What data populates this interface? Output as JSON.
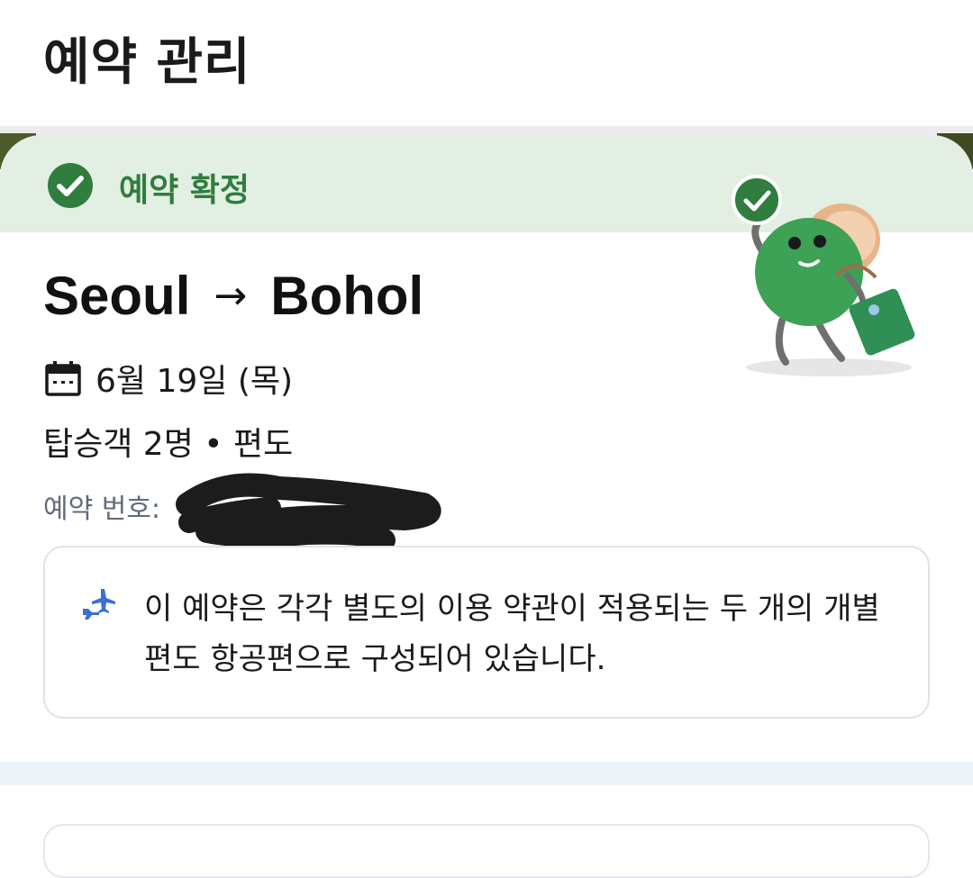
{
  "header": {
    "title": "예약 관리"
  },
  "status": {
    "label": "예약 확정",
    "color": "#2f7d3f"
  },
  "trip": {
    "origin": "Seoul",
    "arrow": "→",
    "destination": "Bohol",
    "date": "6월 19일 (목)",
    "passengers": "탑승객 2명 • 편도",
    "booking_label": "예약 번호:",
    "booking_value": ""
  },
  "notice": {
    "text": "이 예약은 각각 별도의 이용 약관이 적용되는 두 개의 개별 편도 항공편으로 구성되어 있습니다."
  },
  "icons": [
    "check-circle-icon",
    "calendar-icon",
    "planes-icon",
    "mascot-illustration"
  ],
  "colors": {
    "accent_green": "#2f7d3f",
    "banner_bg": "#e3efe2",
    "icon_blue": "#3b6fd4"
  }
}
